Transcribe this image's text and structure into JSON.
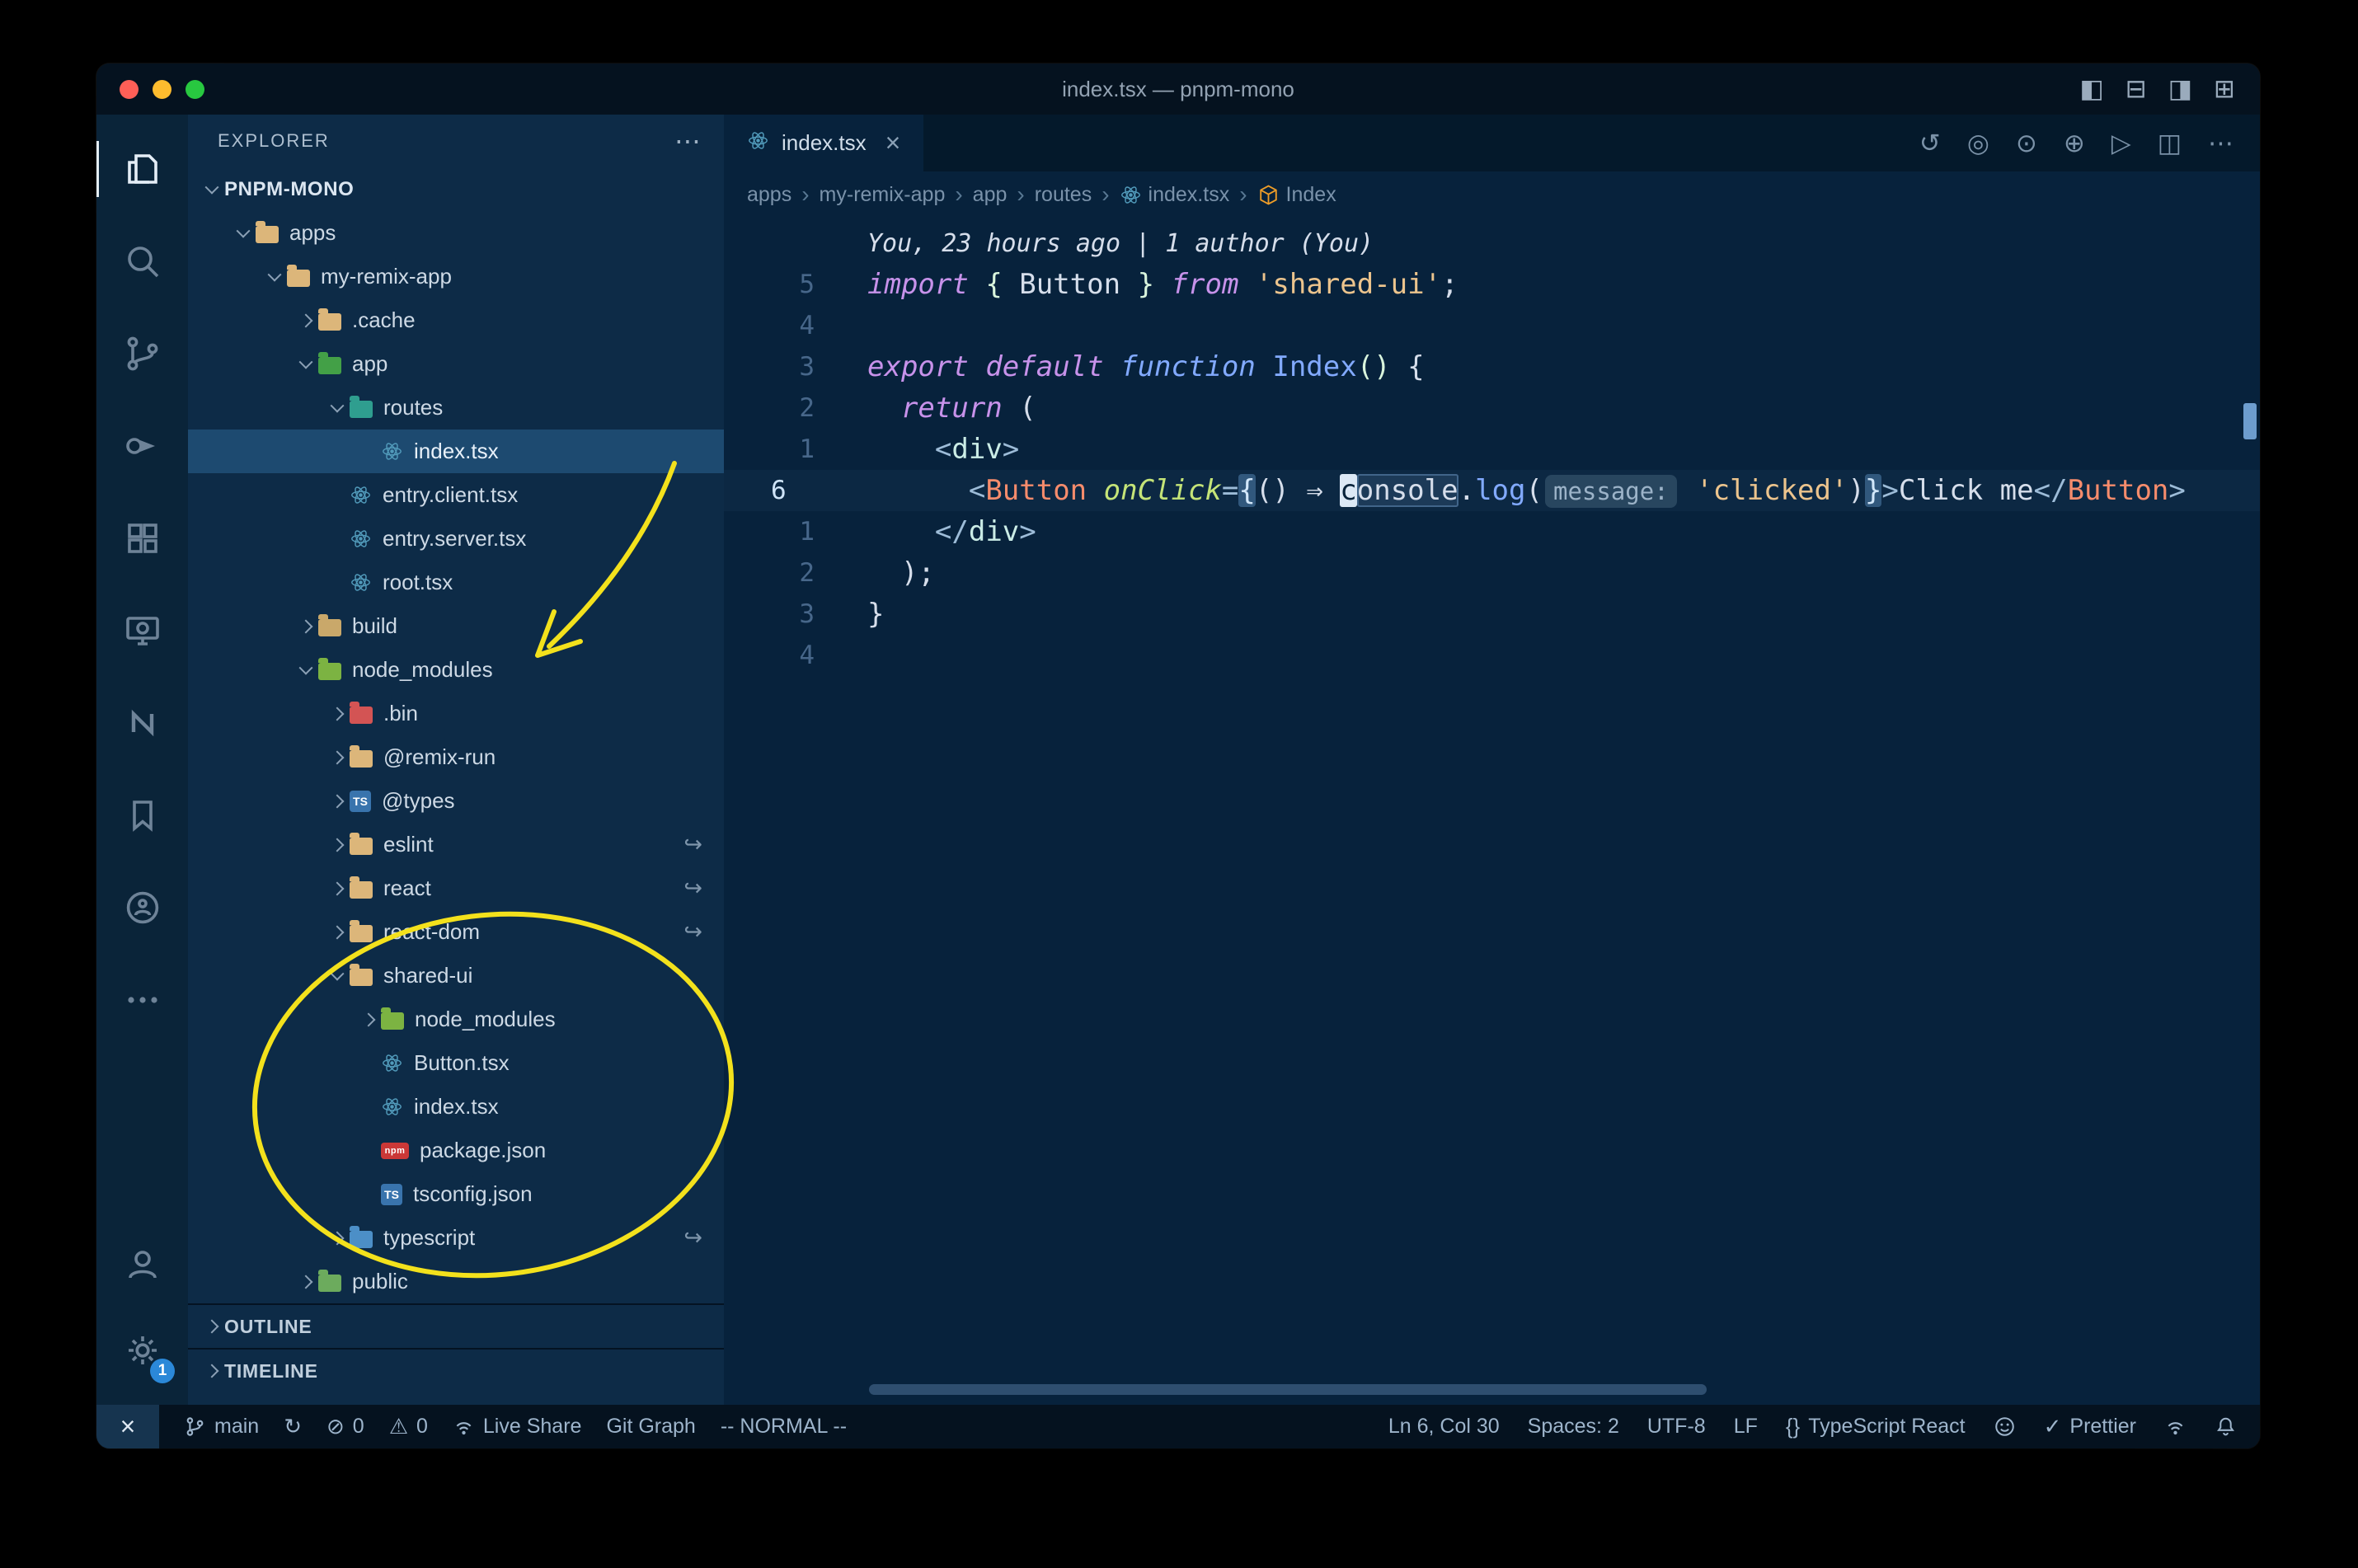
{
  "window": {
    "title": "index.tsx — pnpm-mono"
  },
  "activity_bar": {
    "badge": "1"
  },
  "explorer": {
    "header": "EXPLORER",
    "more_label": "⋯",
    "tree": [
      {
        "label": "PNPM-MONO",
        "indent": 0,
        "kind": "root",
        "chevron": "open",
        "icon": null
      },
      {
        "label": "apps",
        "indent": 1,
        "kind": "folder",
        "chevron": "open",
        "icon": {
          "type": "folder",
          "color": "#dcb67a"
        }
      },
      {
        "label": "my-remix-app",
        "indent": 2,
        "kind": "folder",
        "chevron": "open",
        "icon": {
          "type": "folder",
          "color": "#dcb67a"
        }
      },
      {
        "label": ".cache",
        "indent": 3,
        "kind": "folder",
        "chevron": "closed",
        "icon": {
          "type": "folder",
          "color": "#dcb67a"
        }
      },
      {
        "label": "app",
        "indent": 3,
        "kind": "folder",
        "chevron": "open",
        "icon": {
          "type": "folder",
          "color": "#43a047"
        }
      },
      {
        "label": "routes",
        "indent": 4,
        "kind": "folder",
        "chevron": "open",
        "icon": {
          "type": "folder",
          "color": "#2f9e8f"
        }
      },
      {
        "label": "index.tsx",
        "indent": 5,
        "kind": "file",
        "chevron": null,
        "icon": {
          "type": "react"
        },
        "selected": true
      },
      {
        "label": "entry.client.tsx",
        "indent": 4,
        "kind": "file",
        "chevron": null,
        "icon": {
          "type": "react"
        }
      },
      {
        "label": "entry.server.tsx",
        "indent": 4,
        "kind": "file",
        "chevron": null,
        "icon": {
          "type": "react"
        }
      },
      {
        "label": "root.tsx",
        "indent": 4,
        "kind": "file",
        "chevron": null,
        "icon": {
          "type": "react"
        }
      },
      {
        "label": "build",
        "indent": 3,
        "kind": "folder",
        "chevron": "closed",
        "icon": {
          "type": "folder",
          "color": "#c9a86a"
        }
      },
      {
        "label": "node_modules",
        "indent": 3,
        "kind": "folder",
        "chevron": "open",
        "icon": {
          "type": "folder",
          "color": "#7cb342"
        }
      },
      {
        "label": ".bin",
        "indent": 4,
        "kind": "folder",
        "chevron": "closed",
        "icon": {
          "type": "folder",
          "color": "#d35454"
        }
      },
      {
        "label": "@remix-run",
        "indent": 4,
        "kind": "folder",
        "chevron": "closed",
        "icon": {
          "type": "folder",
          "color": "#dcb67a"
        }
      },
      {
        "label": "@types",
        "indent": 4,
        "kind": "folder",
        "chevron": "closed",
        "icon": {
          "type": "badge",
          "text": "TS",
          "color": "#3974ad"
        }
      },
      {
        "label": "eslint",
        "indent": 4,
        "kind": "folder",
        "chevron": "closed",
        "icon": {
          "type": "folder",
          "color": "#dcb67a"
        },
        "symlink": true
      },
      {
        "label": "react",
        "indent": 4,
        "kind": "folder",
        "chevron": "closed",
        "icon": {
          "type": "folder",
          "color": "#dcb67a"
        },
        "symlink": true
      },
      {
        "label": "react-dom",
        "indent": 4,
        "kind": "folder",
        "chevron": "closed",
        "icon": {
          "type": "folder",
          "color": "#dcb67a"
        },
        "symlink": true
      },
      {
        "label": "shared-ui",
        "indent": 4,
        "kind": "folder",
        "chevron": "open",
        "icon": {
          "type": "folder",
          "color": "#dcb67a"
        }
      },
      {
        "label": "node_modules",
        "indent": 5,
        "kind": "folder",
        "chevron": "closed",
        "icon": {
          "type": "folder",
          "color": "#7cb342"
        }
      },
      {
        "label": "Button.tsx",
        "indent": 5,
        "kind": "file",
        "chevron": null,
        "icon": {
          "type": "react"
        }
      },
      {
        "label": "index.tsx",
        "indent": 5,
        "kind": "file",
        "chevron": null,
        "icon": {
          "type": "react"
        }
      },
      {
        "label": "package.json",
        "indent": 5,
        "kind": "file",
        "chevron": null,
        "icon": {
          "type": "badge",
          "text": "npm",
          "color": "#cb3837"
        }
      },
      {
        "label": "tsconfig.json",
        "indent": 5,
        "kind": "file",
        "chevron": null,
        "icon": {
          "type": "badge",
          "text": "TS",
          "color": "#3974ad"
        }
      },
      {
        "label": "typescript",
        "indent": 4,
        "kind": "folder",
        "chevron": "closed",
        "icon": {
          "type": "folder",
          "color": "#4c8fc7"
        },
        "symlink": true
      },
      {
        "label": "public",
        "indent": 3,
        "kind": "folder",
        "chevron": "closed",
        "icon": {
          "type": "folder",
          "color": "#6cab5d"
        }
      }
    ],
    "sections": [
      {
        "label": "OUTLINE"
      },
      {
        "label": "TIMELINE"
      }
    ]
  },
  "tab": {
    "label": "index.tsx",
    "icon": "react-icon"
  },
  "breadcrumbs": [
    {
      "label": "apps"
    },
    {
      "label": "my-remix-app"
    },
    {
      "label": "app"
    },
    {
      "label": "routes"
    },
    {
      "label": "index.tsx",
      "icon": "react-icon"
    },
    {
      "label": "Index",
      "icon": "symbol-class-icon"
    }
  ],
  "editor": {
    "blame": "You, 23 hours ago | 1 author (You)",
    "lines": [
      {
        "num": "5",
        "segs": [
          [
            "import",
            "kw"
          ],
          [
            " ",
            "plain"
          ],
          [
            "{",
            "punct"
          ],
          [
            " Button ",
            "plain"
          ],
          [
            "}",
            "punct"
          ],
          [
            " ",
            "plain"
          ],
          [
            "from",
            "kw"
          ],
          [
            " ",
            "plain"
          ],
          [
            "'shared-ui'",
            "str"
          ],
          [
            ";",
            "plain"
          ]
        ]
      },
      {
        "num": "4",
        "segs": []
      },
      {
        "num": "3",
        "segs": [
          [
            "export",
            "kw"
          ],
          [
            " ",
            "plain"
          ],
          [
            "default",
            "kw"
          ],
          [
            " ",
            "plain"
          ],
          [
            "function",
            "kwb"
          ],
          [
            " ",
            "plain"
          ],
          [
            "Index",
            "fn"
          ],
          [
            "()",
            "punct"
          ],
          [
            " {",
            "plain"
          ]
        ]
      },
      {
        "num": "2",
        "segs": [
          [
            "  ",
            "plain"
          ],
          [
            "return",
            "kw"
          ],
          [
            " (",
            "plain"
          ]
        ]
      },
      {
        "num": "1",
        "segs": [
          [
            "    ",
            "plain"
          ],
          [
            "<",
            "tagp"
          ],
          [
            "div",
            "tag"
          ],
          [
            ">",
            "tagp"
          ]
        ]
      },
      {
        "num": "6",
        "current": true,
        "segs": [
          [
            "      ",
            "plain"
          ],
          [
            "<",
            "tagp"
          ],
          [
            "Button",
            "comp"
          ],
          [
            " ",
            "plain"
          ],
          [
            "onClick",
            "attr"
          ],
          [
            "=",
            "tagp"
          ],
          [
            "{",
            "brkt"
          ],
          [
            "() ",
            "plain"
          ],
          [
            "⇒",
            "plain"
          ],
          [
            " ",
            "plain"
          ],
          [
            "c",
            "cursor"
          ],
          [
            "onsole",
            "hl"
          ],
          [
            ".",
            "plain"
          ],
          [
            "log",
            "fn"
          ],
          [
            "(",
            "plain"
          ],
          [
            "message:",
            "inlay"
          ],
          [
            " ",
            "plain"
          ],
          [
            "'clicked'",
            "str"
          ],
          [
            ")",
            "plain"
          ],
          [
            "}",
            "brkt"
          ],
          [
            ">",
            "tagp"
          ],
          [
            "Click me",
            "plain"
          ],
          [
            "</",
            "tagp"
          ],
          [
            "Button",
            "comp"
          ],
          [
            ">",
            "tagp"
          ]
        ]
      },
      {
        "num": "1",
        "segs": [
          [
            "    ",
            "plain"
          ],
          [
            "</",
            "tagp"
          ],
          [
            "div",
            "tag"
          ],
          [
            ">",
            "tagp"
          ]
        ]
      },
      {
        "num": "2",
        "segs": [
          [
            "  );",
            "plain"
          ]
        ]
      },
      {
        "num": "3",
        "segs": [
          [
            "}",
            "plain"
          ]
        ]
      },
      {
        "num": "4",
        "segs": []
      }
    ]
  },
  "status_bar": {
    "remote_label": "×",
    "left": [
      {
        "name": "git-branch",
        "icon": "git-branch-icon",
        "label": "main"
      },
      {
        "name": "sync",
        "icon": "sync-icon",
        "label": ""
      },
      {
        "name": "errors",
        "icon": "error-icon",
        "label": "0"
      },
      {
        "name": "warnings",
        "icon": "warning-icon",
        "label": "0"
      },
      {
        "name": "live-share",
        "icon": "live-share-icon",
        "label": "Live Share"
      },
      {
        "name": "git-graph",
        "icon": null,
        "label": "Git Graph"
      },
      {
        "name": "vim-mode",
        "icon": null,
        "label": "-- NORMAL --"
      }
    ],
    "right": [
      {
        "name": "cursor-position",
        "icon": null,
        "label": "Ln 6, Col 30"
      },
      {
        "name": "indentation",
        "icon": null,
        "label": "Spaces: 2"
      },
      {
        "name": "encoding",
        "icon": null,
        "label": "UTF-8"
      },
      {
        "name": "eol",
        "icon": null,
        "label": "LF"
      },
      {
        "name": "language-mode",
        "icon": "braces-icon",
        "label": "TypeScript React"
      },
      {
        "name": "feedback",
        "icon": "smiley-icon",
        "label": ""
      },
      {
        "name": "prettier",
        "icon": "check-icon",
        "label": "Prettier"
      },
      {
        "name": "remote-session",
        "icon": "broadcast-icon",
        "label": ""
      },
      {
        "name": "notifications",
        "icon": "bell-icon",
        "label": ""
      }
    ]
  }
}
